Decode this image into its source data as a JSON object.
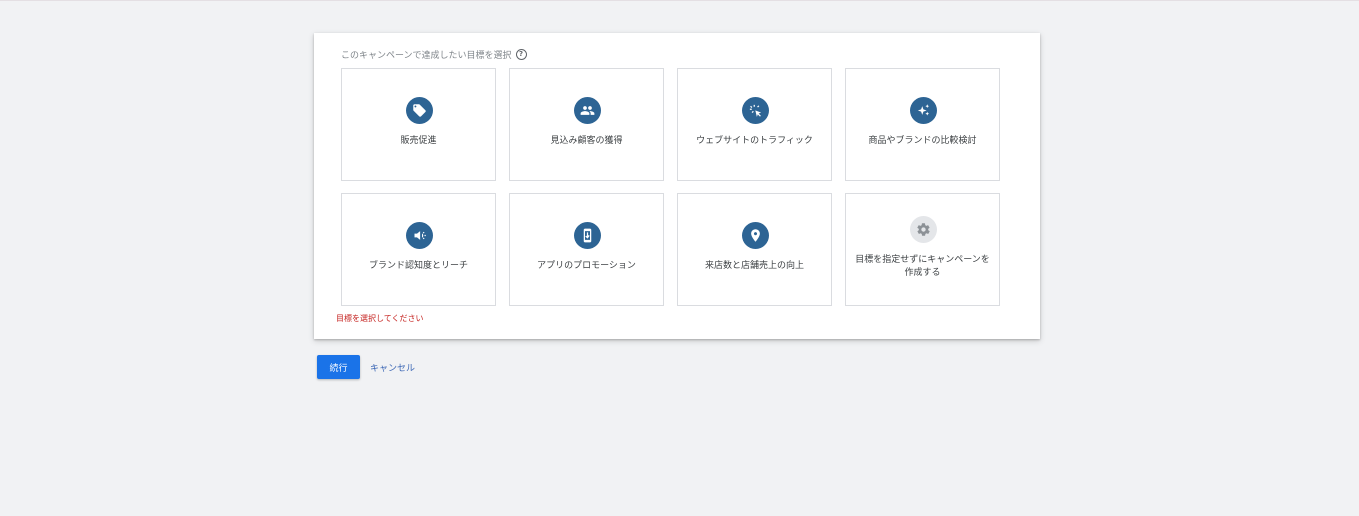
{
  "card": {
    "heading": "このキャンペーンで達成したい目標を選択",
    "help_glyph": "?",
    "error": "目標を選択してください"
  },
  "goals": [
    {
      "label": "販売促進",
      "icon": "tag-icon"
    },
    {
      "label": "見込み顧客の獲得",
      "icon": "people-icon"
    },
    {
      "label": "ウェブサイトのトラフィック",
      "icon": "click-icon"
    },
    {
      "label": "商品やブランドの比較検討",
      "icon": "sparkle-icon"
    },
    {
      "label": "ブランド認知度とリーチ",
      "icon": "megaphone-icon"
    },
    {
      "label": "アプリのプロモーション",
      "icon": "phone-download-icon"
    },
    {
      "label": "来店数と店舗売上の向上",
      "icon": "location-pin-icon"
    },
    {
      "label": "目標を指定せずにキャンペーンを作成する",
      "icon": "gear-icon"
    }
  ],
  "actions": {
    "continue_label": "続行",
    "cancel_label": "キャンセル"
  },
  "colors": {
    "icon_circle": "#2d6494",
    "icon_circle_neutral": "#e4e6e9",
    "primary_button": "#1a73e8",
    "error_text": "#c5221f",
    "link_text": "#3c67b5"
  }
}
